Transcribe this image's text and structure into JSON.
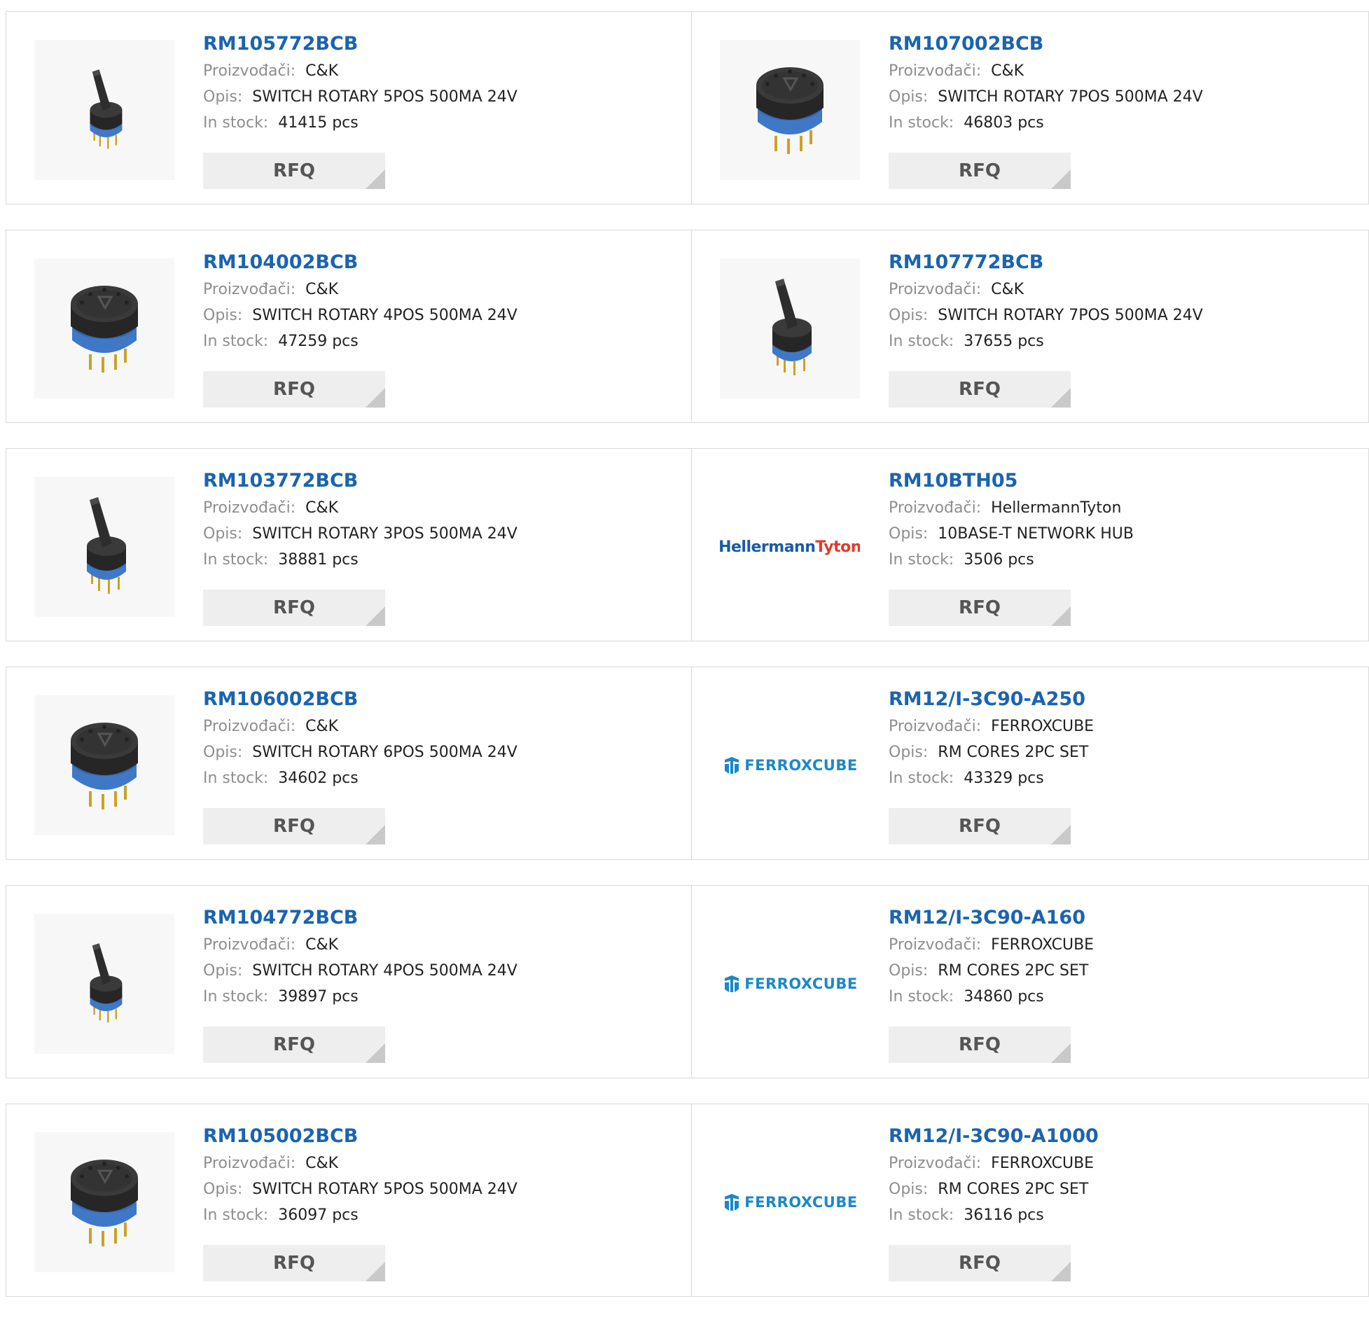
{
  "colors": {
    "part_link": "#1a64b0",
    "label": "#8e8e8e",
    "value": "#222222",
    "rfq_bg": "#eeeeee",
    "border": "#d9d9d9"
  },
  "labels": {
    "manufacturer": "Proizvođači:",
    "description": "Opis:",
    "stock": "In stock:",
    "rfq": "RFQ"
  },
  "logos": {
    "hellermann": {
      "part1": "Hellermann",
      "part2": "Tyton"
    },
    "ferroxcube": "FERROXCUBE"
  },
  "products": [
    {
      "part": "RM105772BCB",
      "manufacturer": "C&K",
      "description": "SWITCH ROTARY 5POS 500MA 24V",
      "stock": "41415 pcs",
      "image": "rotary-switch-shaft-small"
    },
    {
      "part": "RM107002BCB",
      "manufacturer": "C&K",
      "description": "SWITCH ROTARY 7POS 500MA 24V",
      "stock": "46803 pcs",
      "image": "rotary-switch-round"
    },
    {
      "part": "RM104002BCB",
      "manufacturer": "C&K",
      "description": "SWITCH ROTARY 4POS 500MA 24V",
      "stock": "47259 pcs",
      "image": "rotary-switch-round"
    },
    {
      "part": "RM107772BCB",
      "manufacturer": "C&K",
      "description": "SWITCH ROTARY 7POS 500MA 24V",
      "stock": "37655 pcs",
      "image": "rotary-switch-shaft"
    },
    {
      "part": "RM103772BCB",
      "manufacturer": "C&K",
      "description": "SWITCH ROTARY 3POS 500MA 24V",
      "stock": "38881 pcs",
      "image": "rotary-switch-shaft"
    },
    {
      "part": "RM10BTH05",
      "manufacturer": "HellermannTyton",
      "description": "10BASE-T NETWORK HUB",
      "stock": "3506 pcs",
      "image": "hellermanntyton-logo"
    },
    {
      "part": "RM106002BCB",
      "manufacturer": "C&K",
      "description": "SWITCH ROTARY 6POS 500MA 24V",
      "stock": "34602 pcs",
      "image": "rotary-switch-round"
    },
    {
      "part": "RM12/I-3C90-A250",
      "manufacturer": "FERROXCUBE",
      "description": "RM CORES 2PC SET",
      "stock": "43329 pcs",
      "image": "ferroxcube-logo"
    },
    {
      "part": "RM104772BCB",
      "manufacturer": "C&K",
      "description": "SWITCH ROTARY 4POS 500MA 24V",
      "stock": "39897 pcs",
      "image": "rotary-switch-shaft-small"
    },
    {
      "part": "RM12/I-3C90-A160",
      "manufacturer": "FERROXCUBE",
      "description": "RM CORES 2PC SET",
      "stock": "34860 pcs",
      "image": "ferroxcube-logo"
    },
    {
      "part": "RM105002BCB",
      "manufacturer": "C&K",
      "description": "SWITCH ROTARY 5POS 500MA 24V",
      "stock": "36097 pcs",
      "image": "rotary-switch-round"
    },
    {
      "part": "RM12/I-3C90-A1000",
      "manufacturer": "FERROXCUBE",
      "description": "RM CORES 2PC SET",
      "stock": "36116 pcs",
      "image": "ferroxcube-logo"
    }
  ]
}
